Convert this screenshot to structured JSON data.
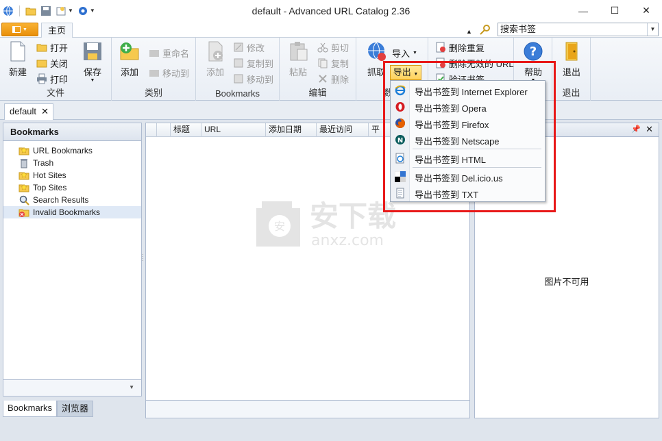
{
  "window": {
    "title": "default - Advanced URL Catalog 2.36",
    "controls": [
      "—",
      "☐",
      "✕"
    ]
  },
  "ribbon_tabs": {
    "home": "主页"
  },
  "search": {
    "value": "搜索书签"
  },
  "groups": {
    "file": {
      "label": "文件",
      "new": "新建",
      "open": "打开",
      "close": "关闭",
      "print": "打印",
      "save": "保存"
    },
    "category": {
      "label": "类别",
      "add": "添加",
      "rename": "重命名",
      "move_to": "移动到"
    },
    "bookmarks": {
      "label": "Bookmarks",
      "add": "添加",
      "edit": "修改",
      "copy_to": "复制到",
      "move_to": "移动到"
    },
    "edit": {
      "label": "编辑",
      "paste": "粘贴",
      "cut": "剪切",
      "copy": "复制",
      "delete": "删除"
    },
    "data": {
      "label": "数",
      "grab": "抓取",
      "import": "导入",
      "export": "导出"
    },
    "tools": {
      "delete_dup": "删除重复",
      "delete_invalid": "删除无效的 URL",
      "verify": "验证书签"
    },
    "help": {
      "label": "帮助",
      "help": "帮助"
    },
    "exit": {
      "label": "退出",
      "exit": "退出"
    }
  },
  "doc_tab": {
    "label": "default",
    "close": "✕"
  },
  "left_pane": {
    "header": "Bookmarks",
    "items": [
      {
        "label": "URL Bookmarks",
        "icon": "star-folder-icon"
      },
      {
        "label": "Trash",
        "icon": "trash-icon"
      },
      {
        "label": "Hot Sites",
        "icon": "star-folder-icon"
      },
      {
        "label": "Top Sites",
        "icon": "star-folder-icon"
      },
      {
        "label": "Search Results",
        "icon": "search-icon"
      },
      {
        "label": "Invalid Bookmarks",
        "icon": "invalid-folder-icon"
      }
    ]
  },
  "bottom_tabs": {
    "bookmarks": "Bookmarks",
    "browser": "浏览器"
  },
  "columns": [
    "标题",
    "URL",
    "添加日期",
    "最近访问",
    "平"
  ],
  "right_pane": {
    "no_image": "图片不可用"
  },
  "watermark": {
    "brand": "安下载",
    "domain": "anxz.com"
  },
  "export_menu": [
    {
      "label": "导出书签到 Internet Explorer",
      "icon": "ie-icon"
    },
    {
      "label": "导出书签到 Opera",
      "icon": "opera-icon"
    },
    {
      "label": "导出书签到 Firefox",
      "icon": "firefox-icon"
    },
    {
      "label": "导出书签到 Netscape",
      "icon": "netscape-icon"
    },
    {
      "label": "导出书签到 HTML",
      "icon": "html-icon"
    },
    {
      "label": "导出书签到 Del.icio.us",
      "icon": "delicious-icon"
    },
    {
      "label": "导出书签到 TXT",
      "icon": "txt-icon"
    }
  ],
  "colors": {
    "highlight": "#e81818",
    "accent": "#f9b233",
    "selection": "#dfe9f6"
  }
}
